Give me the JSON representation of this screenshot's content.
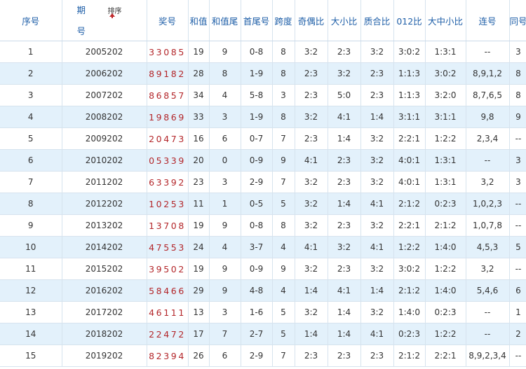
{
  "headers": {
    "seq": "序号",
    "period_top": "期",
    "period_bottom": "号",
    "sort": "排序",
    "prize": "奖号",
    "sum": "和值",
    "sum_tail": "和值尾",
    "head_tail": "首尾号",
    "span": "跨度",
    "odd_even": "奇偶比",
    "big_small": "大小比",
    "prime_comp": "质合比",
    "ratio012": "012比",
    "big_mid_small": "大中小比",
    "consec": "连号",
    "same": "同号"
  },
  "rows": [
    {
      "seq": "1",
      "period": "2005202",
      "prize": "33085",
      "sum": "19",
      "sum_tail": "9",
      "head_tail": "0-8",
      "span": "8",
      "odd_even": "3:2",
      "big_small": "2:3",
      "prime_comp": "3:2",
      "ratio012": "3:0:2",
      "bms": "1:3:1",
      "consec": "--",
      "same": "3"
    },
    {
      "seq": "2",
      "period": "2006202",
      "prize": "89182",
      "sum": "28",
      "sum_tail": "8",
      "head_tail": "1-9",
      "span": "8",
      "odd_even": "2:3",
      "big_small": "3:2",
      "prime_comp": "2:3",
      "ratio012": "1:1:3",
      "bms": "3:0:2",
      "consec": "8,9,1,2",
      "same": "8"
    },
    {
      "seq": "3",
      "period": "2007202",
      "prize": "86857",
      "sum": "34",
      "sum_tail": "4",
      "head_tail": "5-8",
      "span": "3",
      "odd_even": "2:3",
      "big_small": "5:0",
      "prime_comp": "2:3",
      "ratio012": "1:1:3",
      "bms": "3:2:0",
      "consec": "8,7,6,5",
      "same": "8"
    },
    {
      "seq": "4",
      "period": "2008202",
      "prize": "19869",
      "sum": "33",
      "sum_tail": "3",
      "head_tail": "1-9",
      "span": "8",
      "odd_even": "3:2",
      "big_small": "4:1",
      "prime_comp": "1:4",
      "ratio012": "3:1:1",
      "bms": "3:1:1",
      "consec": "9,8",
      "same": "9"
    },
    {
      "seq": "5",
      "period": "2009202",
      "prize": "20473",
      "sum": "16",
      "sum_tail": "6",
      "head_tail": "0-7",
      "span": "7",
      "odd_even": "2:3",
      "big_small": "1:4",
      "prime_comp": "3:2",
      "ratio012": "2:2:1",
      "bms": "1:2:2",
      "consec": "2,3,4",
      "same": "--"
    },
    {
      "seq": "6",
      "period": "2010202",
      "prize": "05339",
      "sum": "20",
      "sum_tail": "0",
      "head_tail": "0-9",
      "span": "9",
      "odd_even": "4:1",
      "big_small": "2:3",
      "prime_comp": "3:2",
      "ratio012": "4:0:1",
      "bms": "1:3:1",
      "consec": "--",
      "same": "3"
    },
    {
      "seq": "7",
      "period": "2011202",
      "prize": "63392",
      "sum": "23",
      "sum_tail": "3",
      "head_tail": "2-9",
      "span": "7",
      "odd_even": "3:2",
      "big_small": "2:3",
      "prime_comp": "3:2",
      "ratio012": "4:0:1",
      "bms": "1:3:1",
      "consec": "3,2",
      "same": "3"
    },
    {
      "seq": "8",
      "period": "2012202",
      "prize": "10253",
      "sum": "11",
      "sum_tail": "1",
      "head_tail": "0-5",
      "span": "5",
      "odd_even": "3:2",
      "big_small": "1:4",
      "prime_comp": "4:1",
      "ratio012": "2:1:2",
      "bms": "0:2:3",
      "consec": "1,0,2,3",
      "same": "--"
    },
    {
      "seq": "9",
      "period": "2013202",
      "prize": "13708",
      "sum": "19",
      "sum_tail": "9",
      "head_tail": "0-8",
      "span": "8",
      "odd_even": "3:2",
      "big_small": "2:3",
      "prime_comp": "3:2",
      "ratio012": "2:2:1",
      "bms": "2:1:2",
      "consec": "1,0,7,8",
      "same": "--"
    },
    {
      "seq": "10",
      "period": "2014202",
      "prize": "47553",
      "sum": "24",
      "sum_tail": "4",
      "head_tail": "3-7",
      "span": "4",
      "odd_even": "4:1",
      "big_small": "3:2",
      "prime_comp": "4:1",
      "ratio012": "1:2:2",
      "bms": "1:4:0",
      "consec": "4,5,3",
      "same": "5"
    },
    {
      "seq": "11",
      "period": "2015202",
      "prize": "39502",
      "sum": "19",
      "sum_tail": "9",
      "head_tail": "0-9",
      "span": "9",
      "odd_even": "3:2",
      "big_small": "2:3",
      "prime_comp": "3:2",
      "ratio012": "3:0:2",
      "bms": "1:2:2",
      "consec": "3,2",
      "same": "--"
    },
    {
      "seq": "12",
      "period": "2016202",
      "prize": "58466",
      "sum": "29",
      "sum_tail": "9",
      "head_tail": "4-8",
      "span": "4",
      "odd_even": "1:4",
      "big_small": "4:1",
      "prime_comp": "1:4",
      "ratio012": "2:1:2",
      "bms": "1:4:0",
      "consec": "5,4,6",
      "same": "6"
    },
    {
      "seq": "13",
      "period": "2017202",
      "prize": "46111",
      "sum": "13",
      "sum_tail": "3",
      "head_tail": "1-6",
      "span": "5",
      "odd_even": "3:2",
      "big_small": "1:4",
      "prime_comp": "3:2",
      "ratio012": "1:4:0",
      "bms": "0:2:3",
      "consec": "--",
      "same": "1"
    },
    {
      "seq": "14",
      "period": "2018202",
      "prize": "22472",
      "sum": "17",
      "sum_tail": "7",
      "head_tail": "2-7",
      "span": "5",
      "odd_even": "1:4",
      "big_small": "1:4",
      "prime_comp": "4:1",
      "ratio012": "0:2:3",
      "bms": "1:2:2",
      "consec": "--",
      "same": "2"
    },
    {
      "seq": "15",
      "period": "2019202",
      "prize": "82394",
      "sum": "26",
      "sum_tail": "6",
      "head_tail": "2-9",
      "span": "7",
      "odd_even": "2:3",
      "big_small": "2:3",
      "prime_comp": "2:3",
      "ratio012": "2:1:2",
      "bms": "2:2:1",
      "consec": "8,9,2,3,4",
      "same": "--"
    }
  ]
}
